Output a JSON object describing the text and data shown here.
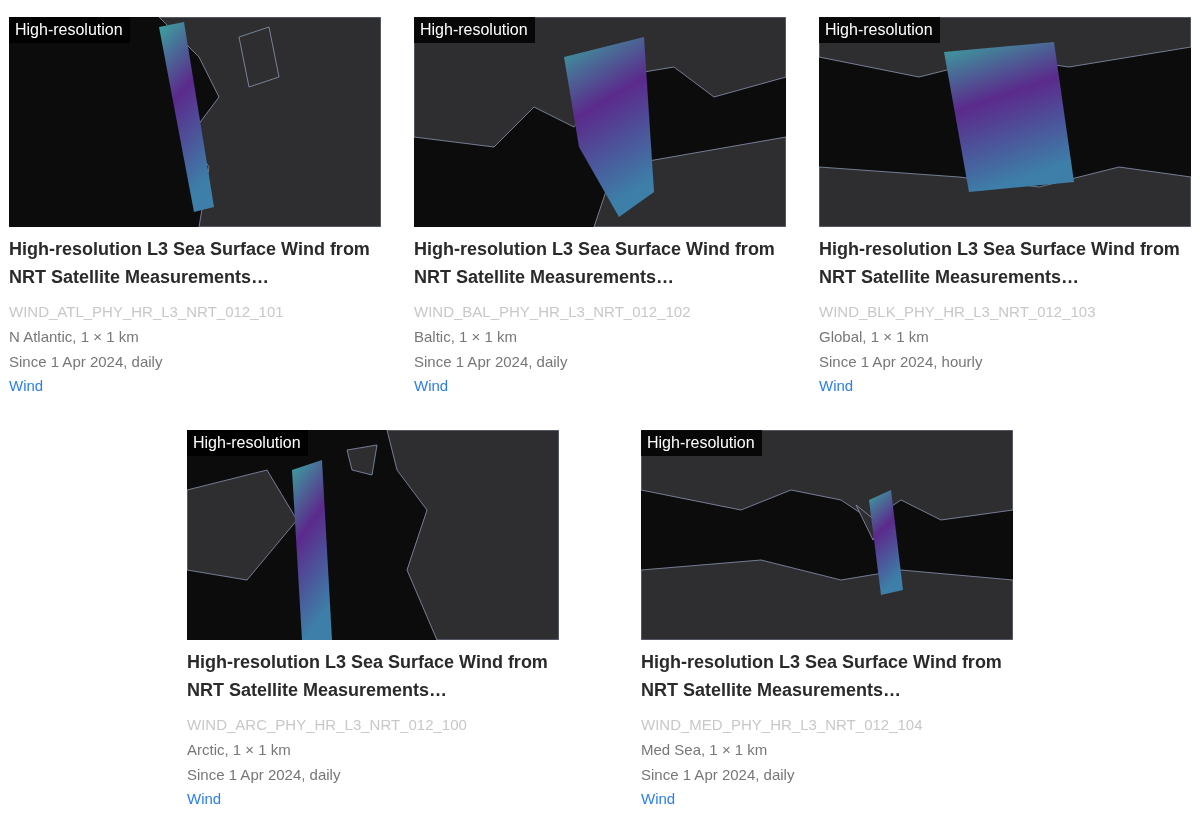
{
  "cards": [
    {
      "badge": "High-resolution",
      "title": "High-resolution L3 Sea Surface Wind from NRT Satellite Measurements…",
      "product_id": "WIND_ATL_PHY_HR_L3_NRT_012_101",
      "coverage": "N Atlantic, 1 × 1 km",
      "period": "Since 1 Apr 2024, daily",
      "tag": "Wind"
    },
    {
      "badge": "High-resolution",
      "title": "High-resolution L3 Sea Surface Wind from NRT Satellite Measurements…",
      "product_id": "WIND_BAL_PHY_HR_L3_NRT_012_102",
      "coverage": "Baltic, 1 × 1 km",
      "period": "Since 1 Apr 2024, daily",
      "tag": "Wind"
    },
    {
      "badge": "High-resolution",
      "title": "High-resolution L3 Sea Surface Wind from NRT Satellite Measurements…",
      "product_id": "WIND_BLK_PHY_HR_L3_NRT_012_103",
      "coverage": "Global, 1 × 1 km",
      "period": "Since 1 Apr 2024, hourly",
      "tag": "Wind"
    },
    {
      "badge": "High-resolution",
      "title": "High-resolution L3 Sea Surface Wind from NRT Satellite Measurements…",
      "product_id": "WIND_ARC_PHY_HR_L3_NRT_012_100",
      "coverage": "Arctic, 1 × 1 km",
      "period": "Since 1 Apr 2024, daily",
      "tag": "Wind"
    },
    {
      "badge": "High-resolution",
      "title": "High-resolution L3 Sea Surface Wind from NRT Satellite Measurements…",
      "product_id": "WIND_MED_PHY_HR_L3_NRT_012_104",
      "coverage": "Med Sea, 1 × 1 km",
      "period": "Since 1 Apr 2024, daily",
      "tag": "Wind"
    }
  ]
}
